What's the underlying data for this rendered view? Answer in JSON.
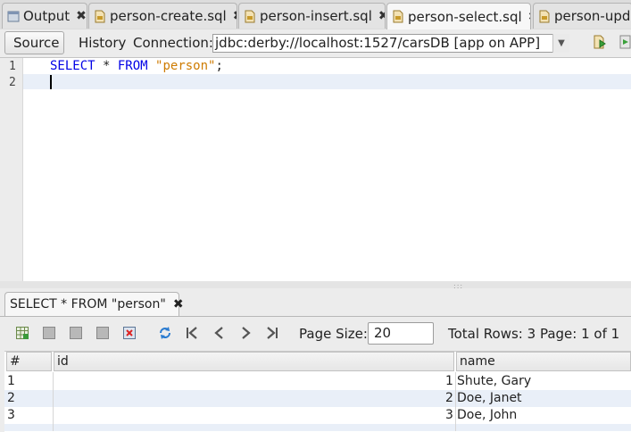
{
  "tabs": [
    {
      "label": "Output",
      "icon": "output-icon",
      "active": false
    },
    {
      "label": "person-create.sql",
      "icon": "sql-file-icon",
      "active": false
    },
    {
      "label": "person-insert.sql",
      "icon": "sql-file-icon",
      "active": false
    },
    {
      "label": "person-select.sql",
      "icon": "sql-file-icon",
      "active": true
    },
    {
      "label": "person-upda",
      "icon": "sql-file-icon",
      "active": false
    }
  ],
  "close_glyph": "✖",
  "toolbar": {
    "source_label": "Source",
    "history_label": "History",
    "connection_label": "Connection:",
    "connection_value": "jdbc:derby://localhost:1527/carsDB [app on APP]"
  },
  "editor": {
    "line_numbers": [
      "1",
      "2"
    ],
    "code": {
      "kw1": "SELECT",
      "star": " * ",
      "kw2": "FROM",
      "space": " ",
      "string": "\"person\"",
      "end": ";"
    }
  },
  "results": {
    "tab_label": "SELECT * FROM \"person\"",
    "page_size_label": "Page Size:",
    "page_size_value": "20",
    "total_rows_text": "Total Rows: 3   Page: 1 of 1",
    "columns": [
      "#",
      "id",
      "name"
    ],
    "rows": [
      {
        "num": "1",
        "id": "1",
        "name": "Shute, Gary"
      },
      {
        "num": "2",
        "id": "2",
        "name": "Doe, Janet"
      },
      {
        "num": "3",
        "id": "3",
        "name": "Doe, John"
      }
    ]
  },
  "colors": {
    "keyword": "#0000e6",
    "string": "#ce7b00",
    "current_line": "#e9eff8"
  }
}
